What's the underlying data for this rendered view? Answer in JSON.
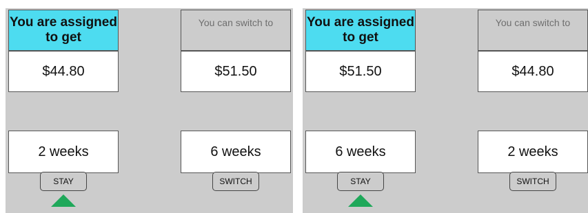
{
  "panels": [
    {
      "assigned_header": "You are assigned to get",
      "switch_header": "You can switch to",
      "assigned_amount": "$44.80",
      "switch_amount": "$51.50",
      "assigned_duration": "2 weeks",
      "switch_duration": "6 weeks",
      "stay_label": "STAY",
      "switch_label": "SWITCH",
      "selected": "stay"
    },
    {
      "assigned_header": "You are assigned to get",
      "switch_header": "You can switch to",
      "assigned_amount": "$51.50",
      "switch_amount": "$44.80",
      "assigned_duration": "6 weeks",
      "switch_duration": "2 weeks",
      "stay_label": "STAY",
      "switch_label": "SWITCH",
      "selected": "stay"
    }
  ],
  "colors": {
    "assigned_header_bg": "#4ddcf0",
    "selection_marker": "#1fa85a",
    "panel_bg": "#cccccc"
  }
}
